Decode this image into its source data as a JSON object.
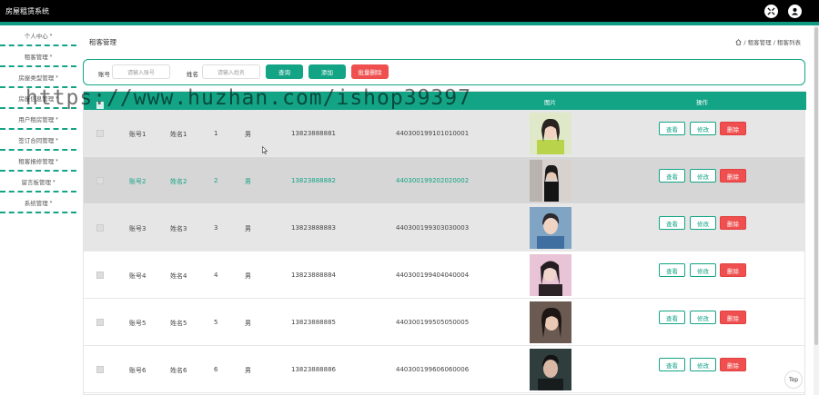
{
  "app": {
    "title": "房屋租赁系统"
  },
  "sidebar": {
    "items": [
      {
        "label": "个人中心"
      },
      {
        "label": "租客管理"
      },
      {
        "label": "房屋类型管理"
      },
      {
        "label": "房屋信息管理"
      },
      {
        "label": "用户租房管理"
      },
      {
        "label": "签订合同管理"
      },
      {
        "label": "租客报修管理"
      },
      {
        "label": "留言板管理"
      },
      {
        "label": "系统管理"
      }
    ]
  },
  "page": {
    "title": "租客管理",
    "breadcrumb": "/ 租客管理 / 租客列表"
  },
  "search": {
    "account_label": "账号",
    "account_placeholder": "请输入账号",
    "name_label": "姓名",
    "name_placeholder": "请输入姓名",
    "query": "查询",
    "add": "添加",
    "batch_delete": "批量删除"
  },
  "table": {
    "headers": {
      "photo": "图片",
      "ops": "操作"
    },
    "buttons": {
      "view": "查看",
      "edit": "修改",
      "delete": "删除"
    },
    "rows": [
      {
        "account": "账号1",
        "name": "姓名1",
        "n": "1",
        "gender": "男",
        "phone": "13823888881",
        "id": "440300199101010001"
      },
      {
        "account": "账号2",
        "name": "姓名2",
        "n": "2",
        "gender": "男",
        "phone": "13823888882",
        "id": "440300199202020002"
      },
      {
        "account": "账号3",
        "name": "姓名3",
        "n": "3",
        "gender": "男",
        "phone": "13823888883",
        "id": "440300199303030003"
      },
      {
        "account": "账号4",
        "name": "姓名4",
        "n": "4",
        "gender": "男",
        "phone": "13823888884",
        "id": "440300199404040004"
      },
      {
        "account": "账号5",
        "name": "姓名5",
        "n": "5",
        "gender": "男",
        "phone": "13823888885",
        "id": "440300199505050005"
      },
      {
        "account": "账号6",
        "name": "姓名6",
        "n": "6",
        "gender": "男",
        "phone": "13823888886",
        "id": "440300199606060006"
      }
    ]
  },
  "watermark": "https://www.huzhan.com/ishop39397",
  "top_button": "Top",
  "colors": {
    "accent": "#13a486",
    "danger": "#ef4f4f",
    "topbar": "#000000"
  }
}
